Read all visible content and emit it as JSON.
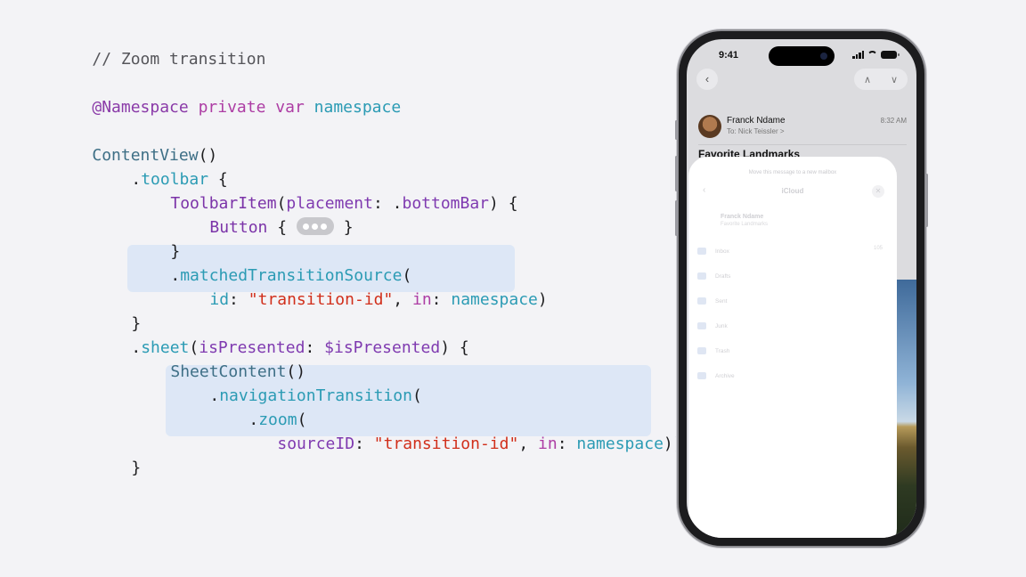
{
  "code": {
    "comment": "// Zoom transition",
    "namespace_attr": "@Namespace",
    "kw_private": "private",
    "kw_var": "var",
    "namespace_ident": "namespace",
    "content_view": "ContentView",
    "parens": "()",
    "toolbar_dot": ".",
    "toolbar": "toolbar",
    "open_brace": " {",
    "toolbar_item": "ToolbarItem",
    "open_paren": "(",
    "placement_label": "placement",
    "colon_dot": ": .",
    "bottom_bar": "bottomBar",
    "close_paren_brace": ") {",
    "button_type": "Button",
    "button_open": " { ",
    "button_close": " }",
    "close_brace": "}",
    "matched_dot": ".",
    "matched_source": "matchedTransitionSource",
    "id_label": "id",
    "colon_space": ": ",
    "transition_id": "\"transition-id\"",
    "comma_space": ", ",
    "in_label": "in",
    "close_paren": ")",
    "sheet_dot": ".",
    "sheet": "sheet",
    "is_presented_label": "isPresented",
    "is_presented_binding": "$isPresented",
    "sheet_content": "SheetContent",
    "nav_dot": ".",
    "navigation_transition": "navigationTransition",
    "zoom_dot": ".",
    "zoom": "zoom",
    "source_id_label": "sourceID",
    "double_close": "))"
  },
  "phone": {
    "time": "9:41",
    "sender": "Franck Ndame",
    "to": "To: Nick Teissler >",
    "mail_time": "8:32 AM",
    "subject": "Favorite Landmarks",
    "back_icon": "chevron-left-icon",
    "sheet": {
      "hint": "Move this message to a new mailbox",
      "title": "iCloud",
      "from": "Franck Ndame",
      "from_sub": "Favorite Landmarks",
      "mailboxes": [
        "Inbox",
        "Drafts",
        "Sent",
        "Junk",
        "Trash",
        "Archive"
      ],
      "inbox_count": "105"
    }
  },
  "colors": {
    "background": "#f3f3f6",
    "highlight": "#dde7f6",
    "keyword": "#ad3da4",
    "string": "#d12f1b",
    "identifier": "#2b9bb4"
  }
}
